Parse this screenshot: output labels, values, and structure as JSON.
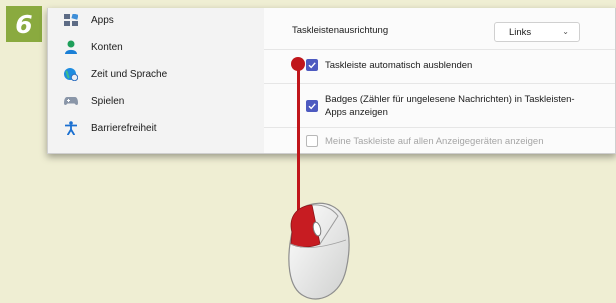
{
  "step": {
    "number": "6"
  },
  "sidebar": {
    "items": [
      {
        "label": "Apps",
        "icon": "apps-icon"
      },
      {
        "label": "Konten",
        "icon": "person-icon"
      },
      {
        "label": "Zeit und Sprache",
        "icon": "globe-clock-icon"
      },
      {
        "label": "Spielen",
        "icon": "gamepad-icon"
      },
      {
        "label": "Barrierefreiheit",
        "icon": "accessibility-icon"
      }
    ]
  },
  "settings": {
    "alignment": {
      "label": "Taskleistenausrichtung",
      "value": "Links"
    },
    "autohide": {
      "label": "Taskleiste automatisch ausblenden",
      "checked": true
    },
    "badges": {
      "line1": "Badges (Zähler für ungelesene Nachrichten) in Taskleisten-",
      "line2": "Apps anzeigen",
      "checked": true
    },
    "all_displays": {
      "label": "Meine Taskleiste auf allen Anzeigegeräten anzeigen",
      "checked": false,
      "disabled": true
    }
  },
  "colors": {
    "accent": "#4d5ac0",
    "pointer": "#c0161b",
    "badge": "#8aaa3f",
    "background": "#efeed3"
  }
}
